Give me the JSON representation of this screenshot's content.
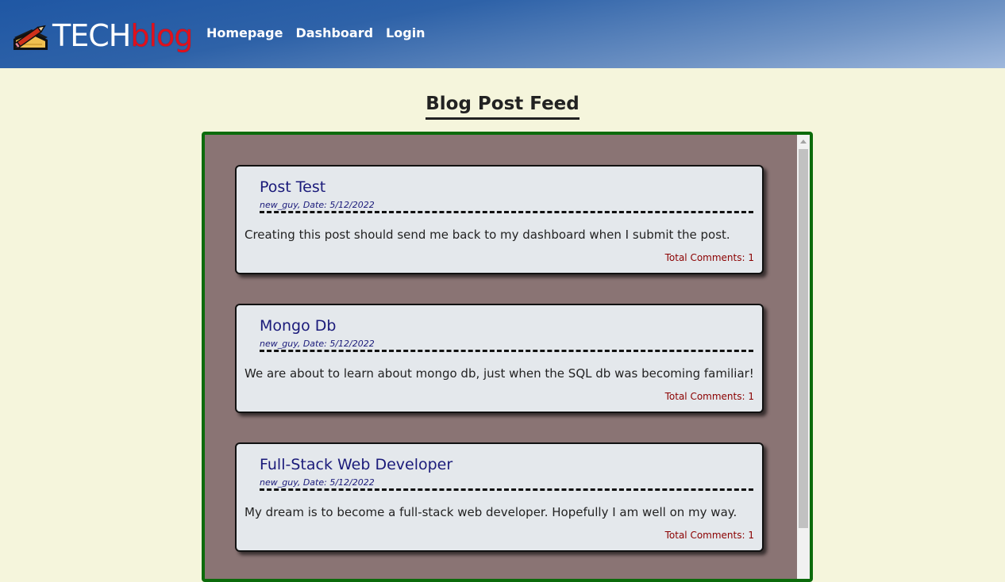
{
  "header": {
    "logo_tech": "TECH",
    "logo_blog": "blog",
    "nav": [
      "Homepage",
      "Dashboard",
      "Login"
    ]
  },
  "main": {
    "title": "Blog Post Feed",
    "posts": [
      {
        "title": "Post Test",
        "meta": "new_guy, Date: 5/12/2022",
        "body": "Creating this post should send me back to my dashboard when I submit the post.",
        "comments": "Total Comments: 1"
      },
      {
        "title": "Mongo Db",
        "meta": "new_guy, Date: 5/12/2022",
        "body": "We are about to learn about mongo db, just when the SQL db was becoming familiar!",
        "comments": "Total Comments: 1"
      },
      {
        "title": "Full-Stack Web Developer",
        "meta": "new_guy, Date: 5/12/2022",
        "body": "My dream is to become a full-stack web developer. Hopefully I am well on my way.",
        "comments": "Total Comments: 1"
      }
    ]
  },
  "icons": {
    "logo": "pencil-notepad-icon"
  },
  "colors": {
    "header_blue": "#1f57a4",
    "page_background": "#f5f5dc",
    "feed_background": "#8a7474",
    "feed_border": "#0b6b0b",
    "card_background": "#e4e8ec",
    "post_title": "#1a1a7a",
    "comments": "#8b0000",
    "logo_blog": "#e0101c"
  }
}
